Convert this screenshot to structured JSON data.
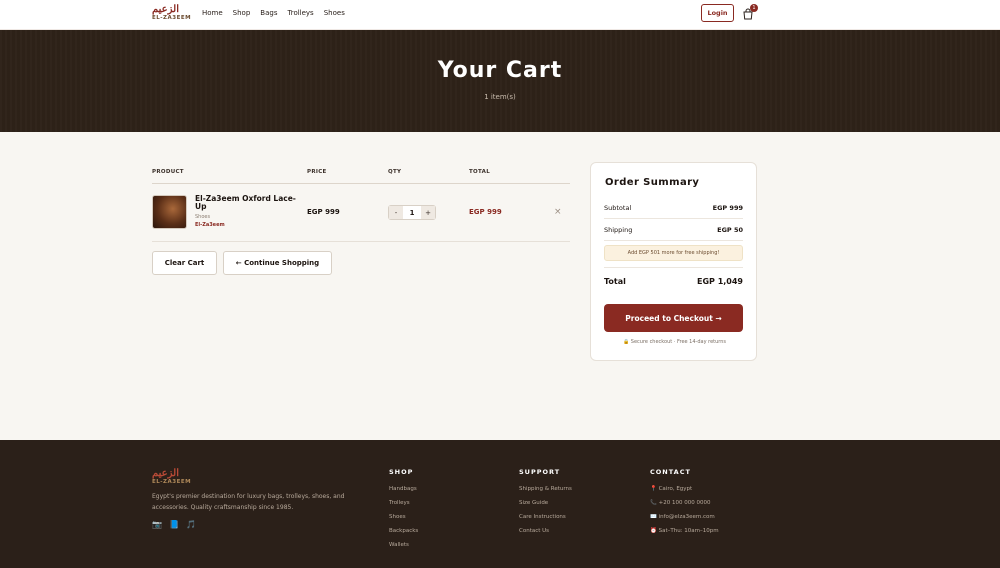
{
  "nav": {
    "logo_ar": "الزعيم",
    "logo_en": "EL-ZA3EEM",
    "links": [
      "Home",
      "Shop",
      "Bags",
      "Trolleys",
      "Shoes"
    ],
    "login_label": "Login",
    "cart_count": "1"
  },
  "hero": {
    "title": "Your Cart",
    "subtitle": "1 item(s)"
  },
  "cart": {
    "columns": [
      "PRODUCT",
      "PRICE",
      "QTY",
      "TOTAL"
    ],
    "items": [
      {
        "name": "El-Za3eem Oxford Lace-Up",
        "category": "Shoes",
        "brand": "El-Za3eem",
        "price": "EGP 999",
        "qty_minus": "-",
        "qty": "1",
        "qty_plus": "+",
        "total": "EGP 999",
        "remove": "×"
      }
    ],
    "clear_label": "Clear Cart",
    "continue_label": "← Continue Shopping"
  },
  "summary": {
    "title": "Order Summary",
    "subtotal_label": "Subtotal",
    "subtotal_value": "EGP 999",
    "shipping_label": "Shipping",
    "shipping_value": "EGP 50",
    "free_shipping_note": "Add EGP 501 more for free shipping!",
    "total_label": "Total",
    "total_value": "EGP 1,049",
    "checkout_label": "Proceed to Checkout →",
    "secure_note": "🔒 Secure checkout · Free 14-day returns"
  },
  "footer": {
    "logo_ar": "الزعيم",
    "logo_en": "EL-ZA3EEM",
    "description": "Egypt's premier destination for luxury bags, trolleys, shoes, and accessories. Quality craftsmanship since 1985.",
    "social": [
      "📷",
      "📘",
      "🎵"
    ],
    "shop": {
      "heading": "SHOP",
      "links": [
        "Handbags",
        "Trolleys",
        "Shoes",
        "Backpacks",
        "Wallets"
      ]
    },
    "support": {
      "heading": "SUPPORT",
      "links": [
        "Shipping & Returns",
        "Size Guide",
        "Care Instructions",
        "Contact Us"
      ]
    },
    "contact": {
      "heading": "CONTACT",
      "lines": [
        "📍 Cairo, Egypt",
        "📞 +20 100 000 0000",
        "✉️ info@elza3eem.com",
        "⏰ Sat–Thu: 10am–10pm"
      ]
    }
  },
  "colors": {
    "accent": "#8a2a22",
    "hero_bg": "#2e2218",
    "footer_bg": "#2b2019",
    "page_bg": "#f8f6f2"
  }
}
